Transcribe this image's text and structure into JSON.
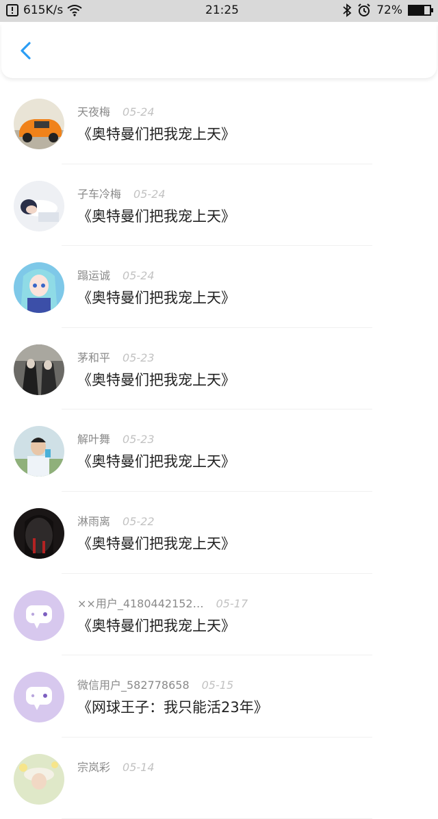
{
  "status_bar": {
    "speed": "615K/s",
    "time": "21:25",
    "battery": "72%",
    "battery_level": 0.72
  },
  "header": {
    "back_icon": "chevron-left-icon",
    "accent": "#2a9df4"
  },
  "comments": [
    {
      "name": "天夜梅",
      "date": "05-24",
      "title": "《奥特曼们把我宠上天》",
      "avatar": "car"
    },
    {
      "name": "子车冷梅",
      "date": "05-24",
      "title": "《奥特曼们把我宠上天》",
      "avatar": "sleeping-person"
    },
    {
      "name": "蹋运诚",
      "date": "05-24",
      "title": "《奥特曼们把我宠上天》",
      "avatar": "anime-girl"
    },
    {
      "name": "茅和平",
      "date": "05-23",
      "title": "《奥特曼们把我宠上天》",
      "avatar": "two-figures"
    },
    {
      "name": "解叶舞",
      "date": "05-23",
      "title": "《奥特曼们把我宠上天》",
      "avatar": "boy-photo"
    },
    {
      "name": "淋雨离",
      "date": "05-22",
      "title": "《奥特曼们把我宠上天》",
      "avatar": "dark-figure"
    },
    {
      "name": "××用户_4180442152…",
      "date": "05-17",
      "title": "《奥特曼们把我宠上天》",
      "avatar": "default-chat"
    },
    {
      "name": "微信用户_582778658",
      "date": "05-15",
      "title": "《网球王子：我只能活23年》",
      "avatar": "default-chat"
    },
    {
      "name": "宗岚彩",
      "date": "05-14",
      "title": "",
      "avatar": "flower-girl"
    }
  ],
  "colors": {
    "status_bar_bg": "#d9d9d9",
    "default_avatar_bg": "#d7c8ee"
  }
}
